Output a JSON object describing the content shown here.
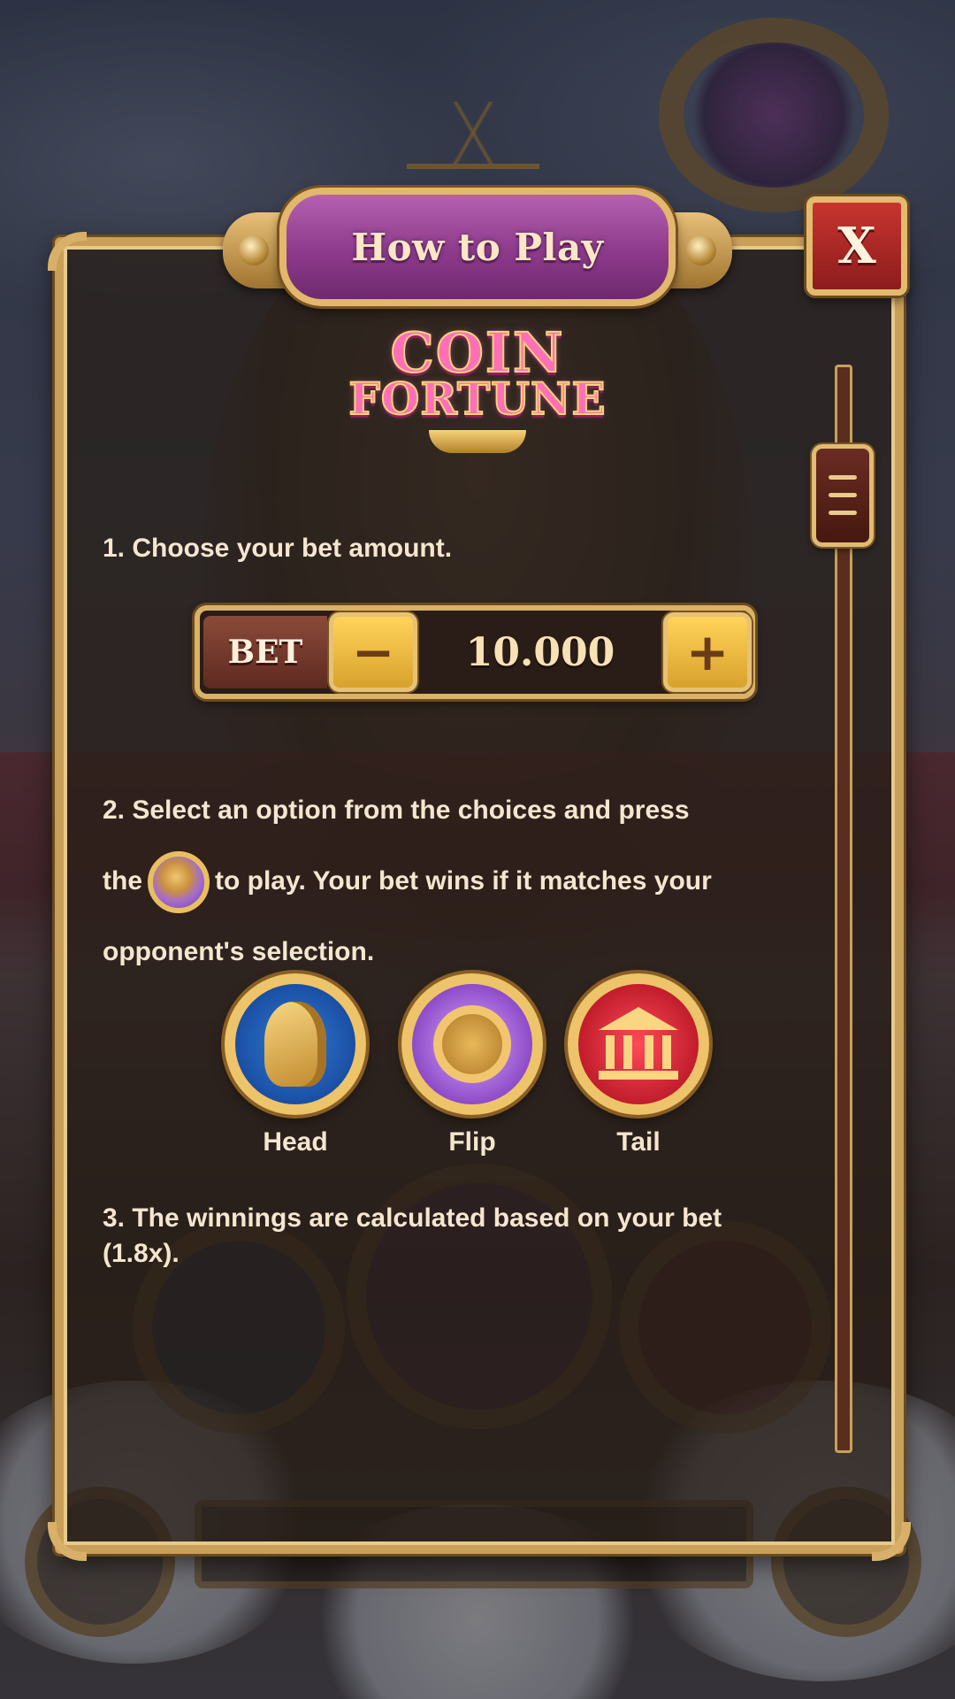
{
  "modal": {
    "title": "How to Play",
    "close_label": "X"
  },
  "logo": {
    "line1": "COIN",
    "line2": "FORTUNE"
  },
  "steps": {
    "step1": "1. Choose your bet amount.",
    "step2_before": "the",
    "step2_intro": "2. Select an option from the choices and press",
    "step2_after": "to play. Your bet wins if it matches your",
    "step2_end": "opponent's selection.",
    "step3": "3. The winnings are calculated based on your bet (1.8x)."
  },
  "bet": {
    "label": "BET",
    "minus": "−",
    "plus": "+",
    "value": "10.000"
  },
  "options": [
    {
      "label": "Head",
      "icon": "head-coin-icon"
    },
    {
      "label": "Flip",
      "icon": "flip-coin-icon"
    },
    {
      "label": "Tail",
      "icon": "tail-coin-icon"
    }
  ],
  "colors": {
    "title_banner": "#8e3a8c",
    "frame_gold": "#c9a05a",
    "close_red": "#c8352f",
    "bet_button_yellow": "#ffd35a",
    "text_cream": "#f4e6cf"
  }
}
